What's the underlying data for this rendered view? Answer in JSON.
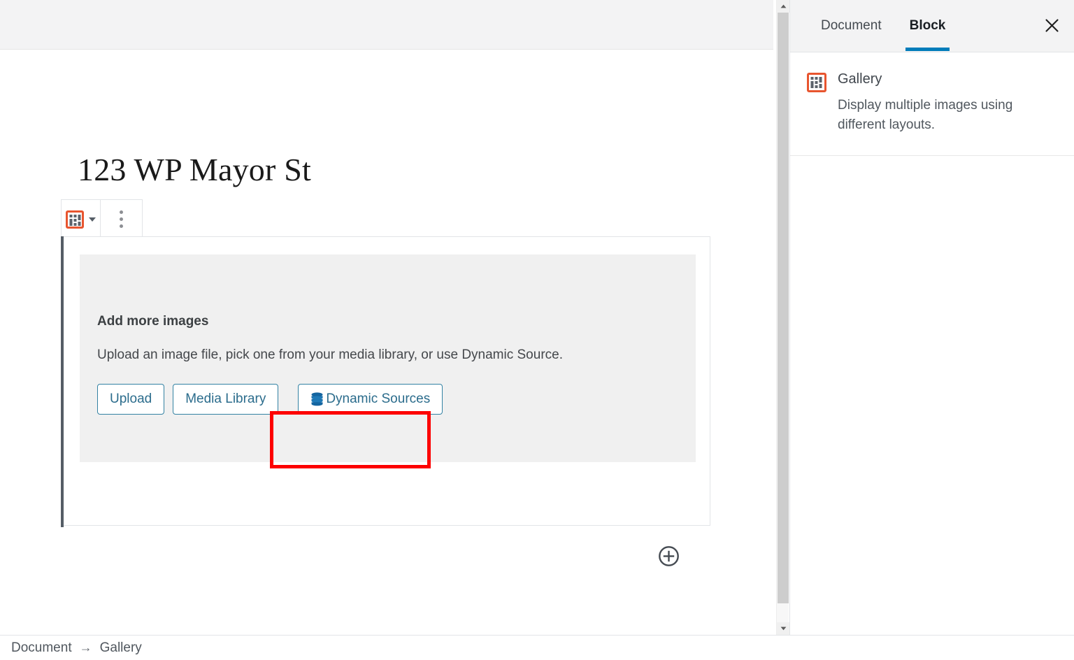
{
  "editor": {
    "post_title": "123 WP Mayor St",
    "toolbar": {
      "block_type_icon": "gallery-grid-icon",
      "block_type_dropdown_icon": "chevron-down-icon",
      "more_options_icon": "kebab-menu-icon"
    },
    "placeholder": {
      "title": "Add more images",
      "description": "Upload an image file, pick one from your media library, or use Dynamic Source.",
      "buttons": [
        {
          "label": "Upload",
          "icon": null
        },
        {
          "label": "Media Library",
          "icon": null
        },
        {
          "label": "Dynamic Sources",
          "icon": "database-icon",
          "highlighted": true
        }
      ]
    },
    "add_block_icon": "plus-circle-icon",
    "scrollbar": {
      "up_icon": "chevron-up-icon",
      "down_icon": "chevron-down-icon"
    }
  },
  "sidebar": {
    "tabs": [
      {
        "label": "Document",
        "active": false
      },
      {
        "label": "Block",
        "active": true
      }
    ],
    "close_icon": "close-icon",
    "block_card": {
      "icon": "gallery-grid-icon",
      "title": "Gallery",
      "description": "Display multiple images using different layouts."
    }
  },
  "footer": {
    "breadcrumb": [
      "Document",
      "Gallery"
    ],
    "separator": "→"
  },
  "colors": {
    "accent_blue": "#007cba",
    "button_blue": "#2b6c8c",
    "icon_orange": "#e8552f",
    "highlight_red": "#fd0000",
    "placeholder_gray": "#f0f0f0",
    "chrome_gray": "#f3f3f4"
  }
}
